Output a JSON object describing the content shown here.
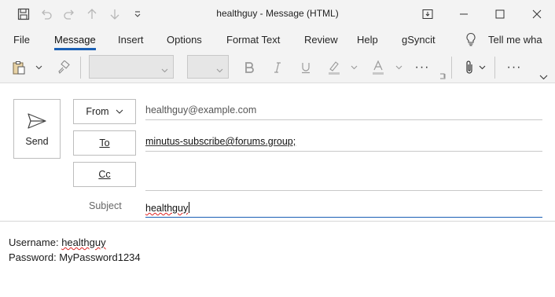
{
  "window": {
    "title": "healthguy  -  Message (HTML)",
    "accent": "#1a5fb4"
  },
  "titlebar": {
    "icons": [
      "save-icon",
      "undo-icon",
      "redo-icon",
      "up-arrow-icon",
      "down-arrow-icon",
      "customize-qat-icon"
    ],
    "controls": [
      "ribbon-display-icon",
      "minimize-icon",
      "maximize-icon",
      "close-icon"
    ]
  },
  "menu": {
    "tabs": [
      "File",
      "Message",
      "Insert",
      "Options",
      "Format Text",
      "Review",
      "Help",
      "gSyncit"
    ],
    "active_tab": "Message",
    "tell_me": "Tell me wha"
  },
  "ribbon": {
    "more": "···",
    "more2": "···"
  },
  "compose": {
    "send_label": "Send",
    "from_label": "From",
    "from_value": "healthguy@example.com",
    "to_label": "To",
    "to_value": "minutus-subscribe@forums.group;",
    "cc_label": "Cc",
    "cc_value": "",
    "subject_label": "Subject",
    "subject_value": "healthguy"
  },
  "body": {
    "line1_prefix": "Username: ",
    "line1_value": "healthguy",
    "line2": "Password: MyPassword1234"
  }
}
